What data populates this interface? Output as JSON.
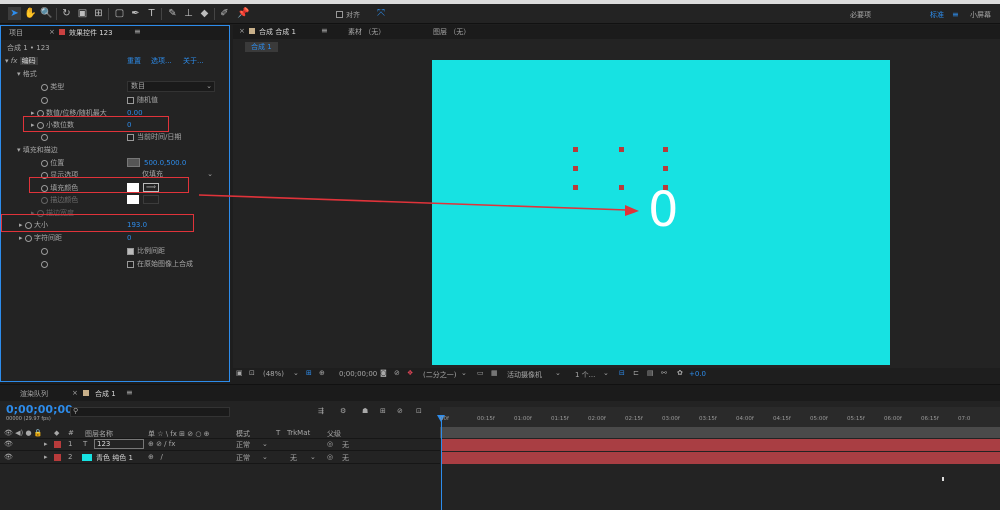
{
  "toolbar": {
    "snap_label": "对齐",
    "workspace_essentials": "必要项",
    "workspace_standard": "标准",
    "workspace_small": "小屏幕"
  },
  "left_panel": {
    "tab_project": "项目",
    "tab_effect_controls": "效果控件 123",
    "breadcrumb": "合成 1 • 123",
    "effect_name": "编码",
    "reset": "重置",
    "options": "选项...",
    "about": "关于...",
    "group_format": "格式",
    "type_label": "类型",
    "type_value": "数目",
    "random_label": "随机值",
    "value_offset_label": "数值/位移/随机最大",
    "value_offset_value": "0.00",
    "decimal_label": "小数位数",
    "decimal_value": "0",
    "current_time_label": "当前时间/日期",
    "group_fill_stroke": "填充和描边",
    "position_label": "位置",
    "position_value": "500.0,500.0",
    "display_options_label": "显示选项",
    "display_options_value": "仅填充",
    "fill_color_label": "填充颜色",
    "stroke_color_label": "描边颜色",
    "stroke_width_label": "描边宽度",
    "size_label": "大小",
    "size_value": "193.0",
    "tracking_label": "字符间距",
    "tracking_value": "0",
    "proportional_label": "比例间距",
    "composite_label": "在原始图像上合成"
  },
  "comp_panel": {
    "tab_comp": "合成 合成 1",
    "footage": "素材 （无）",
    "layer": "图层 （无）",
    "subtab": "合成 1",
    "canvas_digit": "0",
    "canvas_color": "#17e2e2",
    "zoom": "(48%)",
    "timecode": "0;00;00;00",
    "resolution": "(二分之一)",
    "camera": "活动摄像机",
    "views": "1 个...",
    "exposure": "+0.0"
  },
  "timeline": {
    "tab_render": "渲染队列",
    "tab_comp": "合成 1",
    "timecode": "0;00;00;00",
    "timecode_sub": "00000 (29.97 fps)",
    "col_layer_name": "图层名称",
    "col_switches": "单 ☆ \\ fx ⊞ ⊘ ○ ⊕",
    "col_mode": "模式",
    "col_t": "T",
    "col_trkmat": "TrkMat",
    "col_parent": "父级",
    "ruler_ticks": [
      "00f",
      "00:15f",
      "01:00f",
      "01:15f",
      "02:00f",
      "02:15f",
      "03:00f",
      "03:15f",
      "04:00f",
      "04:15f",
      "05:00f",
      "05:15f",
      "06:00f",
      "06:15f",
      "07:0"
    ],
    "layers": [
      {
        "num": "1",
        "type": "T",
        "name": "123",
        "mode": "正常",
        "trkmat": "",
        "parent": "无",
        "color": "#b83b3b"
      },
      {
        "num": "2",
        "type": "",
        "name": "青色 纯色 1",
        "mode": "正常",
        "trkmat": "无",
        "parent": "无",
        "color": "#b83b3b"
      }
    ]
  },
  "colors": {
    "accent": "#2d8ceb",
    "highlight": "#e0333a",
    "canvas": "#17e2e2",
    "layer_bar": "#a93e43"
  }
}
